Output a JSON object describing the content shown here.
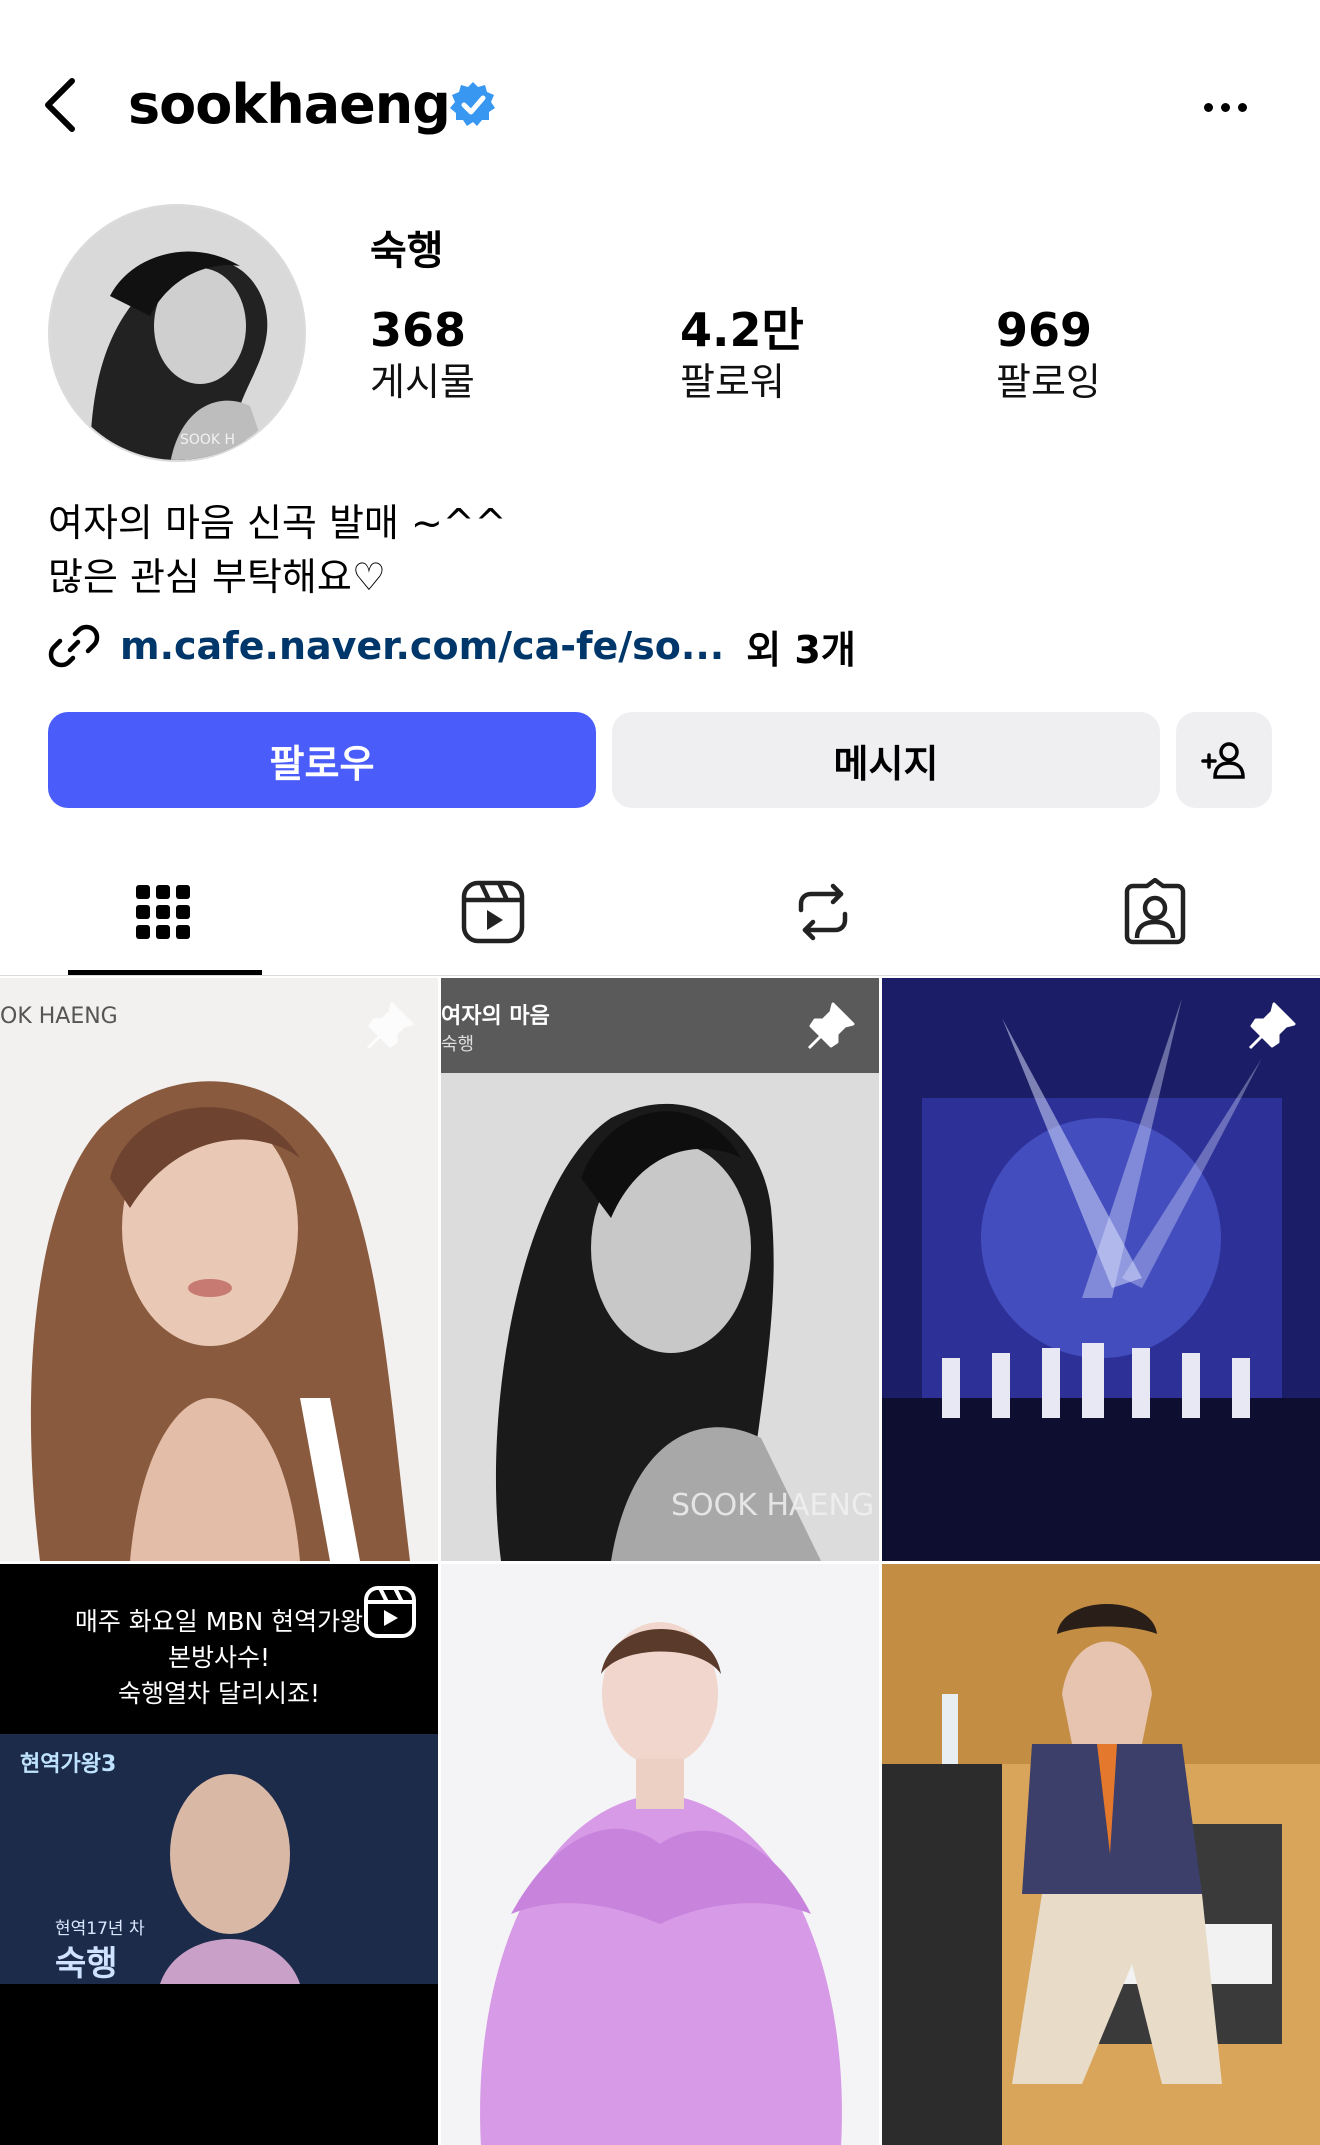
{
  "header": {
    "username": "sookhaeng",
    "back_icon": "chevron-left-icon",
    "verified_icon": "verified-badge-icon",
    "more_icon": "more-horizontal-icon"
  },
  "profile": {
    "display_name": "숙행",
    "avatar_watermark": "SOOK H",
    "stats": [
      {
        "value": "368",
        "label": "게시물"
      },
      {
        "value": "4.2만",
        "label": "팔로워"
      },
      {
        "value": "969",
        "label": "팔로잉"
      }
    ],
    "bio_lines": [
      "여자의 마음 신곡 발매 ~^^",
      "많은 관심 부탁해요♡"
    ],
    "link": {
      "text": "m.cafe.naver.com/ca-fe/so...",
      "more": "외 3개",
      "icon": "link-icon"
    }
  },
  "actions": {
    "follow_label": "팔로우",
    "message_label": "메시지",
    "suggest_icon": "add-person-icon"
  },
  "tabs": [
    {
      "icon": "grid-icon",
      "active": true
    },
    {
      "icon": "reels-icon",
      "active": false
    },
    {
      "icon": "reposts-icon",
      "active": false
    },
    {
      "icon": "tagged-icon",
      "active": false
    }
  ],
  "posts": [
    {
      "kind": "photo",
      "pinned": true,
      "overlay_text": "OK HAENG"
    },
    {
      "kind": "photo",
      "pinned": true,
      "overlay_title": "여자의 마음",
      "overlay_sub": "숙행",
      "watermark": "SOOK HAENG"
    },
    {
      "kind": "photo",
      "pinned": true
    },
    {
      "kind": "reel",
      "lines": [
        "매주 화요일 MBN 현역가왕",
        "본방사수!",
        "숙행열차 달리시죠!"
      ],
      "badge_top": "현역가왕3",
      "badge_sub": "현역17년 차",
      "badge_name": "숙행"
    },
    {
      "kind": "photo"
    },
    {
      "kind": "photo"
    }
  ],
  "colors": {
    "accent": "#4a5dfb",
    "secondary_button": "#efeff2",
    "link": "#00376b",
    "verified": "#3897f0"
  }
}
